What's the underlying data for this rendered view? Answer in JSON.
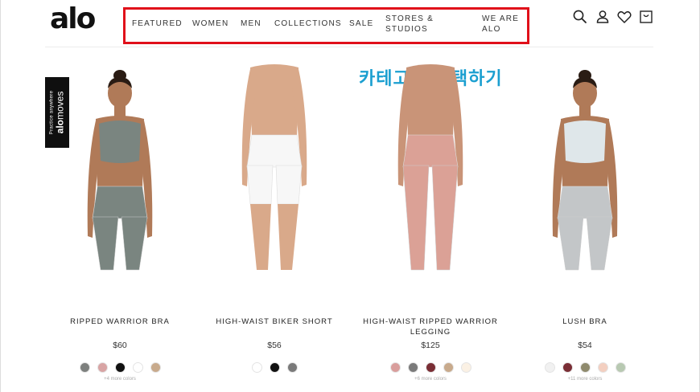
{
  "header": {
    "logo": "alo",
    "nav": [
      {
        "label": "FEATURED",
        "id": "featured"
      },
      {
        "label": "WOMEN",
        "id": "women"
      },
      {
        "label": "MEN",
        "id": "men"
      },
      {
        "label": "COLLECTIONS",
        "id": "collections"
      },
      {
        "label": "SALE",
        "id": "sale"
      },
      {
        "label": "STORES &",
        "label2": "STUDIOS",
        "id": "stores-studios"
      },
      {
        "label": "WE ARE",
        "label2": "ALO",
        "id": "we-are-alo"
      }
    ],
    "icons": [
      "search-icon",
      "account-icon",
      "wishlist-icon",
      "cart-icon"
    ]
  },
  "annotation": "카테고리 선택하기",
  "side_tab": {
    "small": "Practice anywhere",
    "brand_bold": "alo",
    "brand_rest": "moves"
  },
  "products": [
    {
      "name": "RIPPED WARRIOR BRA",
      "price": "$60",
      "more": "+4 more colors",
      "swatches": [
        "#7d807e",
        "#d8a4a4",
        "#111111",
        "#ffffff",
        "#c8aa8c"
      ],
      "top_color": "#7a8580",
      "bottom_color": "#7a8580",
      "skin": "#b07a58"
    },
    {
      "name": "HIGH-WAIST BIKER SHORT",
      "price": "$56",
      "more": "",
      "swatches": [
        "#ffffff",
        "#111111",
        "#7a7a7a"
      ],
      "top_color": "",
      "bottom_color": "#f7f7f7",
      "skin": "#d9a98a"
    },
    {
      "name": "HIGH-WAIST RIPPED WARRIOR",
      "name2": "LEGGING",
      "price": "$125",
      "more": "+6 more colors",
      "swatches": [
        "#d99e9c",
        "#7a7a7a",
        "#7a2e35",
        "#c8aa8c",
        "#fbf1e4"
      ],
      "top_color": "",
      "bottom_color": "#dba196",
      "skin": "#c99478"
    },
    {
      "name": "LUSH BRA",
      "price": "$54",
      "more": "+11 more colors",
      "swatches": [
        "#f1f1f1",
        "#7a2e35",
        "#8f8a6d",
        "#f3cfc0",
        "#b8c9b2"
      ],
      "top_color": "#dfe7ea",
      "bottom_color": "#c3c6c8",
      "skin": "#b07a58"
    }
  ]
}
